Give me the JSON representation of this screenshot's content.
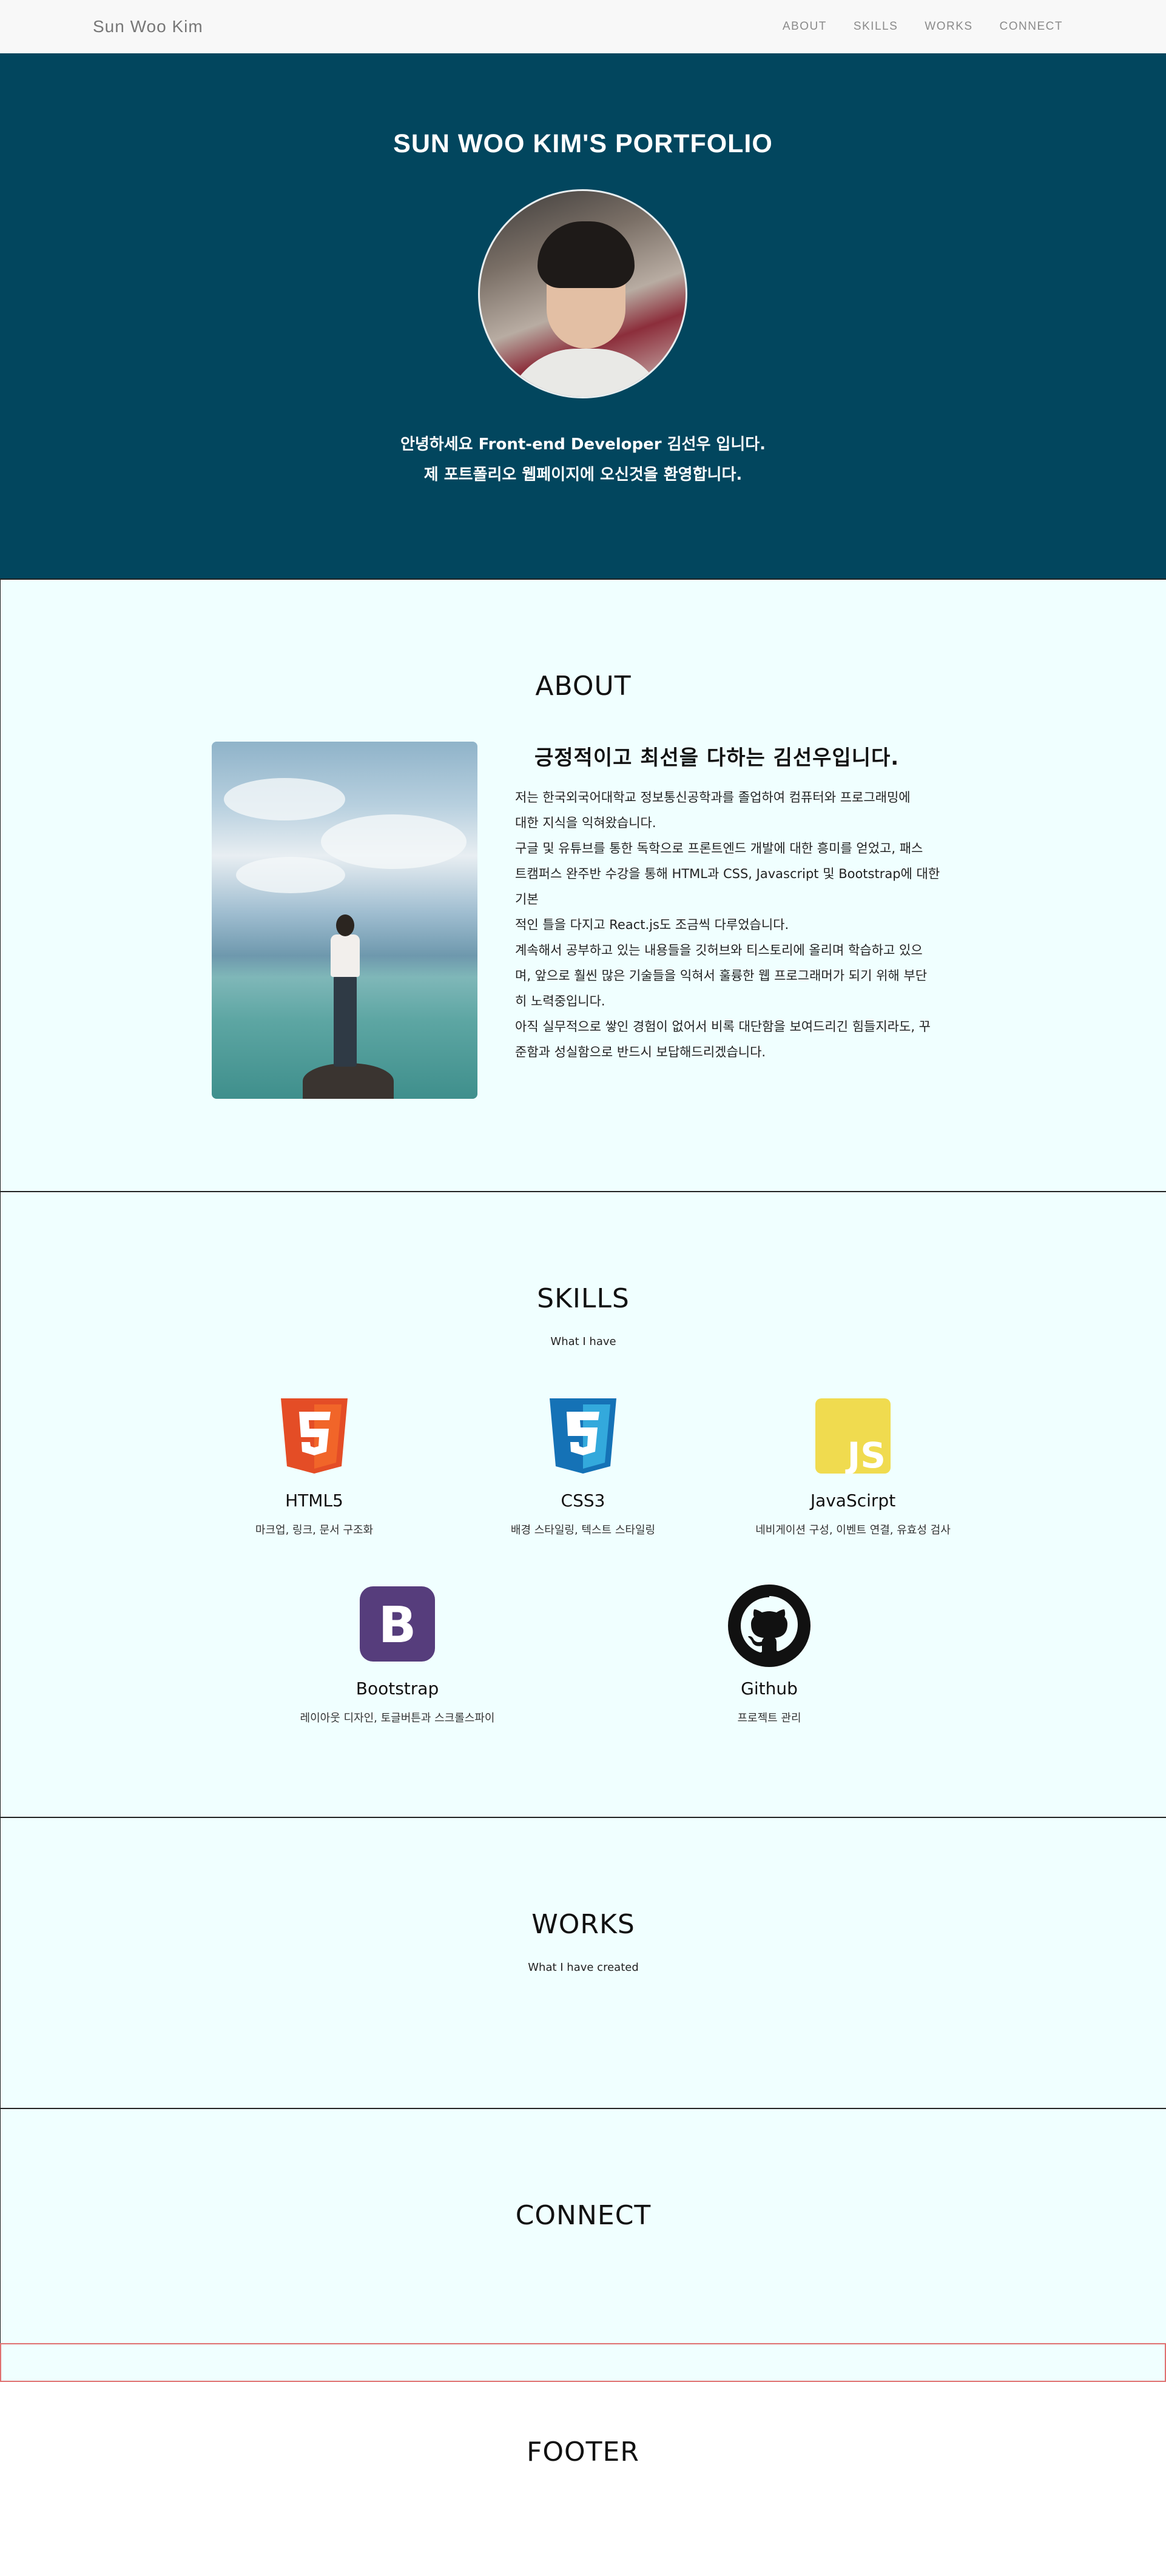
{
  "nav": {
    "brand": "Sun Woo Kim",
    "items": [
      "ABOUT",
      "SKILLS",
      "WORKS",
      "CONNECT"
    ]
  },
  "hero": {
    "title": "SUN WOO KIM'S PORTFOLIO",
    "intro_line1": "안녕하세요 Front-end Developer 김선우 입니다.",
    "intro_line2": "제 포트폴리오 웹페이지에 오신것을 환영합니다."
  },
  "about": {
    "title": "ABOUT",
    "headline": "긍정적이고 최선을 다하는 김선우입니다.",
    "bio": [
      "저는 한국외국어대학교 정보통신공학과를 졸업하여 컴퓨터와 프로그래밍에",
      "대한 지식을 익혀왔습니다.",
      "구글 및 유튜브를 통한 독학으로 프론트엔드 개발에 대한 흥미를 얻었고, 패스",
      "트캠퍼스 완주반 수강을 통해 HTML과 CSS, Javascript 및 Bootstrap에 대한 기본",
      "적인 틀을 다지고 React.js도 조금씩 다루었습니다.",
      "계속해서 공부하고 있는 내용들을 깃허브와 티스토리에 올리며 학습하고 있으",
      "며, 앞으로 훨씬 많은 기술들을 익혀서 훌륭한 웹 프로그래머가 되기 위해 부단",
      "히 노력중입니다.",
      "아직 실무적으로 쌓인 경험이 없어서 비록 대단함을 보여드리긴 힘들지라도, 꾸",
      "준함과 성실함으로 반드시 보답해드리겠습니다."
    ]
  },
  "skills": {
    "title": "SKILLS",
    "subtitle": "What I have",
    "items": [
      {
        "name": "HTML5",
        "desc": "마크업, 링크, 문서 구조화",
        "icon": "html5-icon",
        "color": "#e44d26"
      },
      {
        "name": "CSS3",
        "desc": "배경 스타일링, 텍스트 스타일링",
        "icon": "css3-icon",
        "color": "#1572b6"
      },
      {
        "name": "JavaScirpt",
        "desc": "네비게이션 구성, 이벤트 연결, 유효성 검사",
        "icon": "js-icon",
        "color": "#f0db4f"
      },
      {
        "name": "Bootstrap",
        "desc": "레이아웃 디자인, 토글버튼과 스크롤스파이",
        "icon": "bootstrap-icon",
        "color": "#563d7c"
      },
      {
        "name": "Github",
        "desc": "프로젝트 관리",
        "icon": "github-icon",
        "color": "#111111"
      }
    ]
  },
  "works": {
    "title": "WORKS",
    "subtitle": "What I have created"
  },
  "connect": {
    "title": "CONNECT"
  },
  "footer": {
    "title": "FOOTER"
  },
  "colors": {
    "hero_bg": "#02465e",
    "section_bg": "#f0ffff",
    "nav_bg": "#f8f8f8"
  }
}
